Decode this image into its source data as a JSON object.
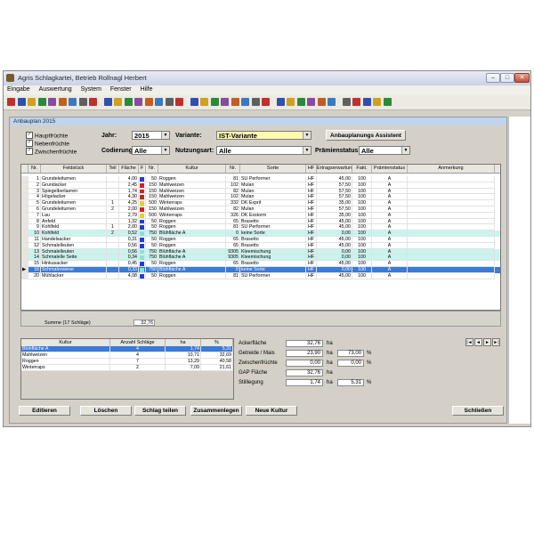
{
  "window": {
    "title": "Agris Schlagkartei, Betrieb Rollnagl Herbert"
  },
  "menu": [
    "Eingabe",
    "Auswertung",
    "System",
    "Fenster",
    "Hilfe"
  ],
  "document": {
    "title": "Anbauplan 2015"
  },
  "filters": {
    "checkboxes": [
      {
        "label": "Hauptfrüchte",
        "checked": true
      },
      {
        "label": "Nebenfrüchte",
        "checked": true
      },
      {
        "label": "Zwischenfrüchte",
        "checked": true
      }
    ],
    "year_label": "Jahr:",
    "year_value": "2015",
    "variant_label": "Variante:",
    "variant_value": "IST-Variante",
    "coding_label": "Codierung:",
    "coding_value": "Alle",
    "usage_label": "Nutzungsart:",
    "usage_value": "Alle",
    "premium_label": "Prämienstatus:",
    "premium_value": "Alle",
    "assistant_button": "Anbauplanungs Assistent"
  },
  "grid": {
    "headers": [
      "Nr.",
      "Feldstück",
      "Teil",
      "Fläche",
      "F",
      "Nr.",
      "Kultur",
      "Nr.",
      "Sorte",
      "HF",
      "Ertragserwartung",
      "Fakt.",
      "Prämienstatus",
      "Anmerkung"
    ],
    "rows": [
      {
        "nr": "1",
        "feld": "Grundeleiturnen",
        "teil": "",
        "flaeche": "4,00",
        "color": "#1f3dd6",
        "knr": "50",
        "kultur": "Roggen",
        "snr": "81",
        "sorte": "SU Performer",
        "hf": "HF",
        "ertrag": "45,00",
        "fakt": "100",
        "praemie": "A"
      },
      {
        "nr": "2",
        "feld": "Grundacker",
        "teil": "",
        "flaeche": "2,45",
        "color": "#d62020",
        "knr": "150",
        "kultur": "Mahlweizen",
        "snr": "102",
        "sorte": "Mulan",
        "hf": "HF",
        "ertrag": "57,50",
        "fakt": "100",
        "praemie": "A"
      },
      {
        "nr": "3",
        "feld": "Spiegelberlaeren",
        "teil": "",
        "flaeche": "1,74",
        "color": "#d62020",
        "knr": "150",
        "kultur": "Mahlweizen",
        "snr": "82",
        "sorte": "Mulan",
        "hf": "HF",
        "ertrag": "57,50",
        "fakt": "100",
        "praemie": "A"
      },
      {
        "nr": "4",
        "feld": "Högelacker",
        "teil": "",
        "flaeche": "4,30",
        "color": "#d62020",
        "knr": "150",
        "kultur": "Mahlweizen",
        "snr": "102",
        "sorte": "Mulan",
        "hf": "HF",
        "ertrag": "57,50",
        "fakt": "100",
        "praemie": "A"
      },
      {
        "nr": "5",
        "feld": "Grundeleiturnen",
        "teil": "1",
        "flaeche": "4,25",
        "color": "#e8d020",
        "knr": "500",
        "kultur": "Winterraps",
        "snr": "332",
        "sorte": "DK Exprit",
        "hf": "HF",
        "ertrag": "35,00",
        "fakt": "100",
        "praemie": "A"
      },
      {
        "nr": "6",
        "feld": "Grundeleiturnen",
        "teil": "2",
        "flaeche": "2,00",
        "color": "#d62020",
        "knr": "150",
        "kultur": "Mahlweizen",
        "snr": "82",
        "sorte": "Mulan",
        "hf": "HF",
        "ertrag": "57,50",
        "fakt": "100",
        "praemie": "A"
      },
      {
        "nr": "7",
        "feld": "Lau",
        "teil": "",
        "flaeche": "2,79",
        "color": "#e8d020",
        "knr": "500",
        "kultur": "Winterraps",
        "snr": "326",
        "sorte": "DK Exstorm",
        "hf": "HF",
        "ertrag": "35,00",
        "fakt": "100",
        "praemie": "A"
      },
      {
        "nr": "8",
        "feld": "Anfeld",
        "teil": "",
        "flaeche": "1,32",
        "color": "#1f3dd6",
        "knr": "50",
        "kultur": "Roggen",
        "snr": "65",
        "sorte": "Brasetto",
        "hf": "HF",
        "ertrag": "45,00",
        "fakt": "100",
        "praemie": "A"
      },
      {
        "nr": "9",
        "feld": "Kohlfeld",
        "teil": "1",
        "flaeche": "2,00",
        "color": "#1f3dd6",
        "knr": "50",
        "kultur": "Roggen",
        "snr": "81",
        "sorte": "SU Performer",
        "hf": "HF",
        "ertrag": "45,00",
        "fakt": "100",
        "praemie": "A"
      },
      {
        "nr": "10",
        "feld": "Kohlfeld",
        "teil": "2",
        "flaeche": "0,52",
        "color": "#7fe8d8",
        "knr": "750",
        "kultur": "Blühfläche A",
        "snr": "0",
        "sorte": "keine Sorte",
        "hf": "HF",
        "ertrag": "0,00",
        "fakt": "100",
        "praemie": "A"
      },
      {
        "nr": "11",
        "feld": "Handelsacker",
        "teil": "",
        "flaeche": "0,31",
        "color": "#1f3dd6",
        "knr": "50",
        "kultur": "Roggen",
        "snr": "65",
        "sorte": "Brasetto",
        "hf": "HF",
        "ertrag": "45,00",
        "fakt": "100",
        "praemie": "A"
      },
      {
        "nr": "12",
        "feld": "Schmalelleuten",
        "teil": "",
        "flaeche": "0,56",
        "color": "#1f3dd6",
        "knr": "50",
        "kultur": "Roggen",
        "snr": "65",
        "sorte": "Brasetto",
        "hf": "HF",
        "ertrag": "45,00",
        "fakt": "100",
        "praemie": "A"
      },
      {
        "nr": "13",
        "feld": "Schmalelleuten",
        "teil": "",
        "flaeche": "0,56",
        "color": "#7fe8d8",
        "knr": "750",
        "kultur": "Blühfläche A",
        "snr": "9305",
        "sorte": "Kleemischung",
        "hf": "HF",
        "ertrag": "0,00",
        "fakt": "100",
        "praemie": "A"
      },
      {
        "nr": "14",
        "feld": "Schmalelle Seite",
        "teil": "",
        "flaeche": "0,34",
        "color": "#7fe8d8",
        "knr": "750",
        "kultur": "Blühfläche A",
        "snr": "9305",
        "sorte": "Kleemischung",
        "hf": "HF",
        "ertrag": "0,00",
        "fakt": "100",
        "praemie": "A"
      },
      {
        "nr": "15",
        "feld": "Hinkusacker",
        "teil": "",
        "flaeche": "0,45",
        "color": "#1f3dd6",
        "knr": "50",
        "kultur": "Roggen",
        "snr": "65",
        "sorte": "Brasetto",
        "hf": "HF",
        "ertrag": "45,00",
        "fakt": "100",
        "praemie": "A"
      },
      {
        "nr": "16",
        "feld": "Schmalerwiese",
        "teil": "",
        "flaeche": "0,33",
        "color": "#7fe8d8",
        "knr": "750",
        "kultur": "Blühfläche A",
        "snr": "0",
        "sorte": "keine Sorte",
        "hf": "HF",
        "ertrag": "0,00",
        "fakt": "100",
        "praemie": "A"
      },
      {
        "nr": "20",
        "feld": "Mühlacker",
        "teil": "",
        "flaeche": "4,08",
        "color": "#1f3dd6",
        "knr": "50",
        "kultur": "Roggen",
        "snr": "81",
        "sorte": "SU Performer",
        "hf": "HF",
        "ertrag": "45,00",
        "fakt": "100",
        "praemie": "A"
      }
    ],
    "selected_row": 15,
    "sum_label": "Summe (17 Schläge)",
    "sum_value": "32,76"
  },
  "summary": {
    "headers": [
      "Kultur",
      "Anzahl Schläge",
      "ha",
      "%"
    ],
    "rows": [
      {
        "kultur": "Blühfläche A",
        "anzahl": "4",
        "ha": "1,74",
        "pct": "5,31"
      },
      {
        "kultur": "Mahlweizen",
        "anzahl": "4",
        "ha": "10,71",
        "pct": "32,69"
      },
      {
        "kultur": "Roggen",
        "anzahl": "7",
        "ha": "13,29",
        "pct": "40,58"
      },
      {
        "kultur": "Winterraps",
        "anzahl": "2",
        "ha": "7,09",
        "pct": "21,61"
      }
    ]
  },
  "stats": [
    {
      "label": "Ackerfläche",
      "value": "32,76",
      "unit": "ha",
      "pct": "",
      "pctunit": ""
    },
    {
      "label": "Getreide / Mais",
      "value": "23,90",
      "unit": "ha",
      "pct": "73,00",
      "pctunit": "%"
    },
    {
      "label": "Zwischenfrüchte",
      "value": "0,00",
      "unit": "ha",
      "pct": "0,00",
      "pctunit": "%"
    },
    {
      "label": "GAP Fläche",
      "value": "32,76",
      "unit": "ha",
      "pct": "",
      "pctunit": ""
    },
    {
      "label": "Stilllegung",
      "value": "1,74",
      "unit": "ha",
      "pct": "5,31",
      "pctunit": "%"
    }
  ],
  "buttons": {
    "edit": "Editieren",
    "delete": "Löschen",
    "split": "Schlag teilen",
    "merge": "Zusammenlegen",
    "new": "Neue Kultur",
    "close": "Schließen"
  },
  "nav": [
    "|◄",
    "◄",
    "►",
    "►|"
  ],
  "colors": {
    "selected_row": "#3b7ad6",
    "teal_row": "#c8f4ee",
    "title_grad": "#c2d4ec"
  }
}
